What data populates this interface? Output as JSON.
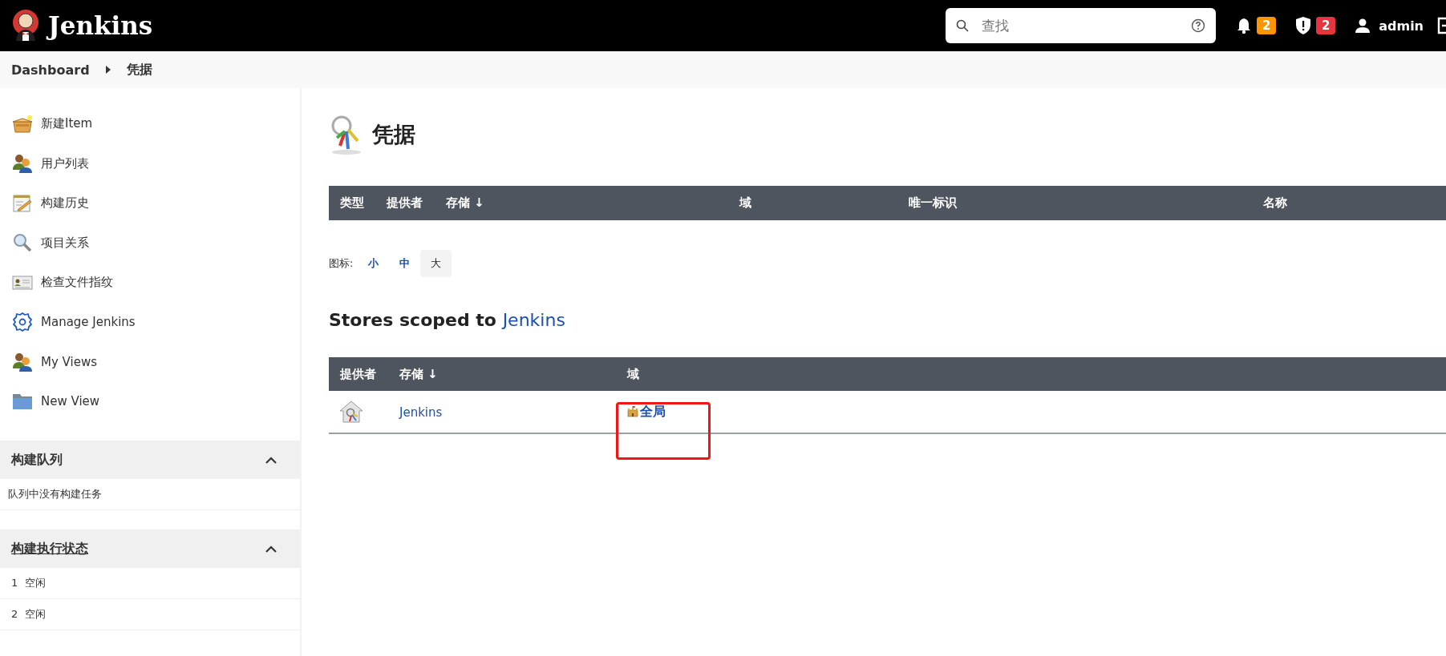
{
  "header": {
    "logo_text": "Jenkins",
    "search": {
      "placeholder": "查找"
    },
    "notifications": "2",
    "security_alerts": "2",
    "user": "admin"
  },
  "breadcrumb": [
    {
      "label": "Dashboard"
    },
    {
      "label": "凭据"
    }
  ],
  "sidebar": {
    "items": [
      {
        "label": "新建Item",
        "kind": "box"
      },
      {
        "label": "用户列表",
        "kind": "people"
      },
      {
        "label": "构建历史",
        "kind": "notepad"
      },
      {
        "label": "项目关系",
        "kind": "magnifier"
      },
      {
        "label": "检查文件指纹",
        "kind": "card"
      },
      {
        "label": "Manage Jenkins",
        "kind": "gear"
      },
      {
        "label": "My Views",
        "kind": "people"
      },
      {
        "label": "New View",
        "kind": "folder"
      }
    ],
    "panels": [
      {
        "title": "构建队列",
        "expanded": true,
        "underlined": false,
        "rows": [
          "队列中没有构建任务"
        ]
      },
      {
        "title": "构建执行状态",
        "expanded": true,
        "underlined": true,
        "rows": [
          "1  空闲",
          "2  空闲"
        ]
      }
    ]
  },
  "page_title": "凭据",
  "credentials_table": {
    "columns": [
      "类型",
      "提供者",
      "存储 ↓",
      "域",
      "唯一标识",
      "名称"
    ]
  },
  "icon_size": {
    "label": "图标:",
    "options": [
      {
        "label": "小",
        "selected": false
      },
      {
        "label": "中",
        "selected": false
      },
      {
        "label": "大",
        "selected": true
      }
    ]
  },
  "stores_heading": {
    "text": "Stores scoped to",
    "link": "Jenkins"
  },
  "stores_table": {
    "columns": [
      "提供者",
      "存储 ↓",
      "域"
    ],
    "rows": [
      {
        "store": "Jenkins",
        "domain": "全局"
      }
    ]
  }
}
